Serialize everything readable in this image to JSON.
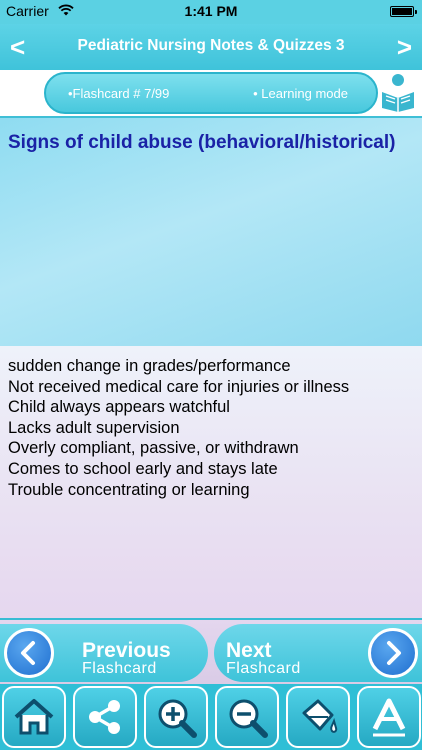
{
  "status_bar": {
    "carrier": "Carrier",
    "time": "1:41 PM"
  },
  "nav": {
    "title": "Pediatric Nursing Notes & Quizzes 3",
    "back_glyph": "<",
    "forward_glyph": ">"
  },
  "info": {
    "flashcard_label": "•Flashcard #  7/99",
    "mode_label": "• Learning mode"
  },
  "question": {
    "text": "Signs of child abuse (behavioral/historical)"
  },
  "answer": {
    "lines": [
      "sudden change in grades/performance",
      "Not received medical care for injuries or illness",
      "Child always appears watchful",
      "Lacks adult supervision",
      "Overly compliant, passive, or withdrawn",
      "Comes to school early and stays late",
      "Trouble concentrating or learning"
    ]
  },
  "navigation": {
    "previous": {
      "line1": "Previous",
      "line2": "Flashcard"
    },
    "next": {
      "line1": "Next",
      "line2": "Flashcard"
    }
  },
  "toolbar_icons": [
    "home-icon",
    "share-icon",
    "zoom-in-icon",
    "zoom-out-icon",
    "paint-bucket-icon",
    "font-icon"
  ],
  "colors": {
    "accent": "#3fc3da",
    "question_text": "#1a22a6",
    "nav_button": "#1f6fd0"
  }
}
